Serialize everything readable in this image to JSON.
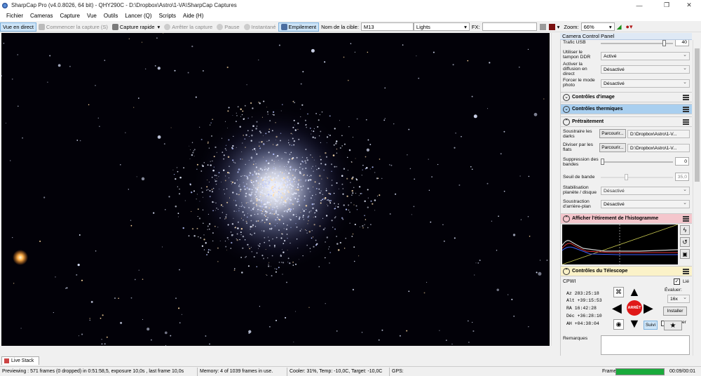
{
  "window": {
    "title": "SharpCap Pro (v4.0.8026, 64 bit) - QHY290C - D:\\Dropbox\\Astro\\1-VA\\SharpCap Captures",
    "minimize": "—",
    "maximize": "❐",
    "close": "✕"
  },
  "menu": [
    "Fichier",
    "Cameras",
    "Capture",
    "Vue",
    "Outils",
    "Lancer (Q)",
    "Scripts",
    "Aide (H)"
  ],
  "toolbar": {
    "live_view": "Vue en direct",
    "start_capture": "Commencer la capture (S)",
    "quick_capture": "Capture rapide",
    "stop_capture": "Arrêter la capture",
    "pause": "Pause",
    "snapshot": "Instantané",
    "stacking": "Empilement",
    "target_label": "Nom de la cible:",
    "target_value": "M13",
    "frame_type": "Lights",
    "fx_label": "FX:",
    "fx_value": "",
    "zoom_label": "Zoom:",
    "zoom_value": "66%"
  },
  "live_stack_tab": "Live Stack",
  "status": {
    "preview": "Previewing : 571 frames (0 dropped) in 0:51:58,5, exposure 10,0s , last frame 10,0s",
    "memory": "Memory: 4 of 1039 frames in use.",
    "cooler": "Cooler: 31%, Temp: -10,0C, Target: -10,0C",
    "gps": "GPS:",
    "frame_label": "Frame:",
    "frame_progress": 1.0,
    "frame_time": "00:09/00:01"
  },
  "panel": {
    "title": "Camera Control Panel",
    "usb": {
      "label": "Trafic USB",
      "value": "40",
      "level": 0.9
    },
    "ddr": {
      "label": "Utiliser le tampon DDR",
      "value": "Activé"
    },
    "live_diffusion": {
      "label": "Activer la diffusion en direct",
      "value": "Désactivé"
    },
    "photo_mode": {
      "label": "Forcer le mode photo",
      "value": "Désactivé"
    },
    "section_image": "Contrôles d'image",
    "section_thermal": "Contrôles thermiques",
    "section_preprocess": "Prétraitement",
    "darks": {
      "label": "Soustraire les darks",
      "button": "Parcourir...",
      "path": "D:\\Dropbox\\Astro\\1-V..."
    },
    "flats": {
      "label": "Diviser par les flats",
      "button": "Parcourir...",
      "path": "D:\\Dropbox\\Astro\\1-V..."
    },
    "banding": {
      "label": "Suppression des bandes",
      "value": "0",
      "level": 0.0
    },
    "band_threshold": {
      "label": "Seuil de bande",
      "value": "35,0",
      "level": 0.35
    },
    "stabilization": {
      "label": "Stabilisation planète / disque",
      "value": "Désactivé"
    },
    "background": {
      "label": "Soustraction d'arrière-plan",
      "value": "Désactivé"
    },
    "section_histogram": "Afficher l'étirement de l'histogramme",
    "section_telescope": "Contrôles du Télescope",
    "telescope": {
      "mount": "CPWI",
      "linked_label": "Lié",
      "linked": true,
      "az": "Az   283:25:18",
      "alt": "Alt  +39:15:53",
      "ra": "RA    16:42:28",
      "dec": "Déc  +36:28:10",
      "ha": "AH   +04:38:04",
      "rate_label": "Évaluer:",
      "rate_value": "16x",
      "install": "Installer",
      "park_label": "se garer",
      "stop": "ARRÊT",
      "tracking": "Suivi",
      "star_icon": "★"
    },
    "remarks_label": "Remarques"
  }
}
